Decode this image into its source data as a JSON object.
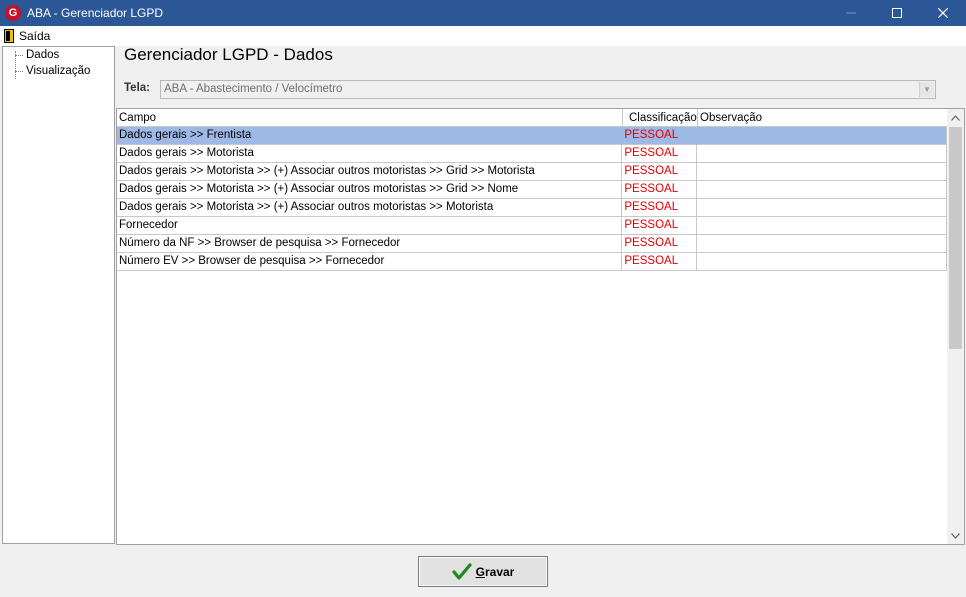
{
  "window": {
    "title": "ABA - Gerenciador LGPD",
    "icon_letter": "G",
    "brand_color": "#c8102e",
    "titlebar_color": "#2b5797"
  },
  "menu": {
    "items": [
      {
        "label": "Saída",
        "icon": "door-exit-icon"
      }
    ]
  },
  "tree": {
    "items": [
      {
        "label": "Dados"
      },
      {
        "label": "Visualização"
      }
    ]
  },
  "main": {
    "title": "Gerenciador LGPD - Dados",
    "screen_label": "Tela:",
    "screen_value": "ABA - Abastecimento / Velocímetro"
  },
  "grid": {
    "columns": [
      "Campo",
      "Classificação",
      "Observação"
    ],
    "selected_row_color": "#9fb9e6",
    "classification_color": "#e00000",
    "rows": [
      {
        "campo": "Dados gerais >> Frentista",
        "classificacao": "PESSOAL",
        "observacao": "",
        "selected": true
      },
      {
        "campo": "Dados gerais >> Motorista",
        "classificacao": "PESSOAL",
        "observacao": ""
      },
      {
        "campo": "Dados gerais >> Motorista >> (+) Associar outros motoristas >> Grid >> Motorista",
        "classificacao": "PESSOAL",
        "observacao": ""
      },
      {
        "campo": "Dados gerais >> Motorista >> (+) Associar outros motoristas >> Grid >> Nome",
        "classificacao": "PESSOAL",
        "observacao": ""
      },
      {
        "campo": "Dados gerais >> Motorista >> (+) Associar outros motoristas >> Motorista",
        "classificacao": "PESSOAL",
        "observacao": ""
      },
      {
        "campo": "Fornecedor",
        "classificacao": "PESSOAL",
        "observacao": ""
      },
      {
        "campo": "Número da NF >> Browser de pesquisa >> Fornecedor",
        "classificacao": "PESSOAL",
        "observacao": ""
      },
      {
        "campo": "Número EV >> Browser de pesquisa >> Fornecedor",
        "classificacao": "PESSOAL",
        "observacao": ""
      }
    ]
  },
  "footer": {
    "save_label_first": "G",
    "save_label_rest": "ravar",
    "save_icon": "check-icon"
  }
}
